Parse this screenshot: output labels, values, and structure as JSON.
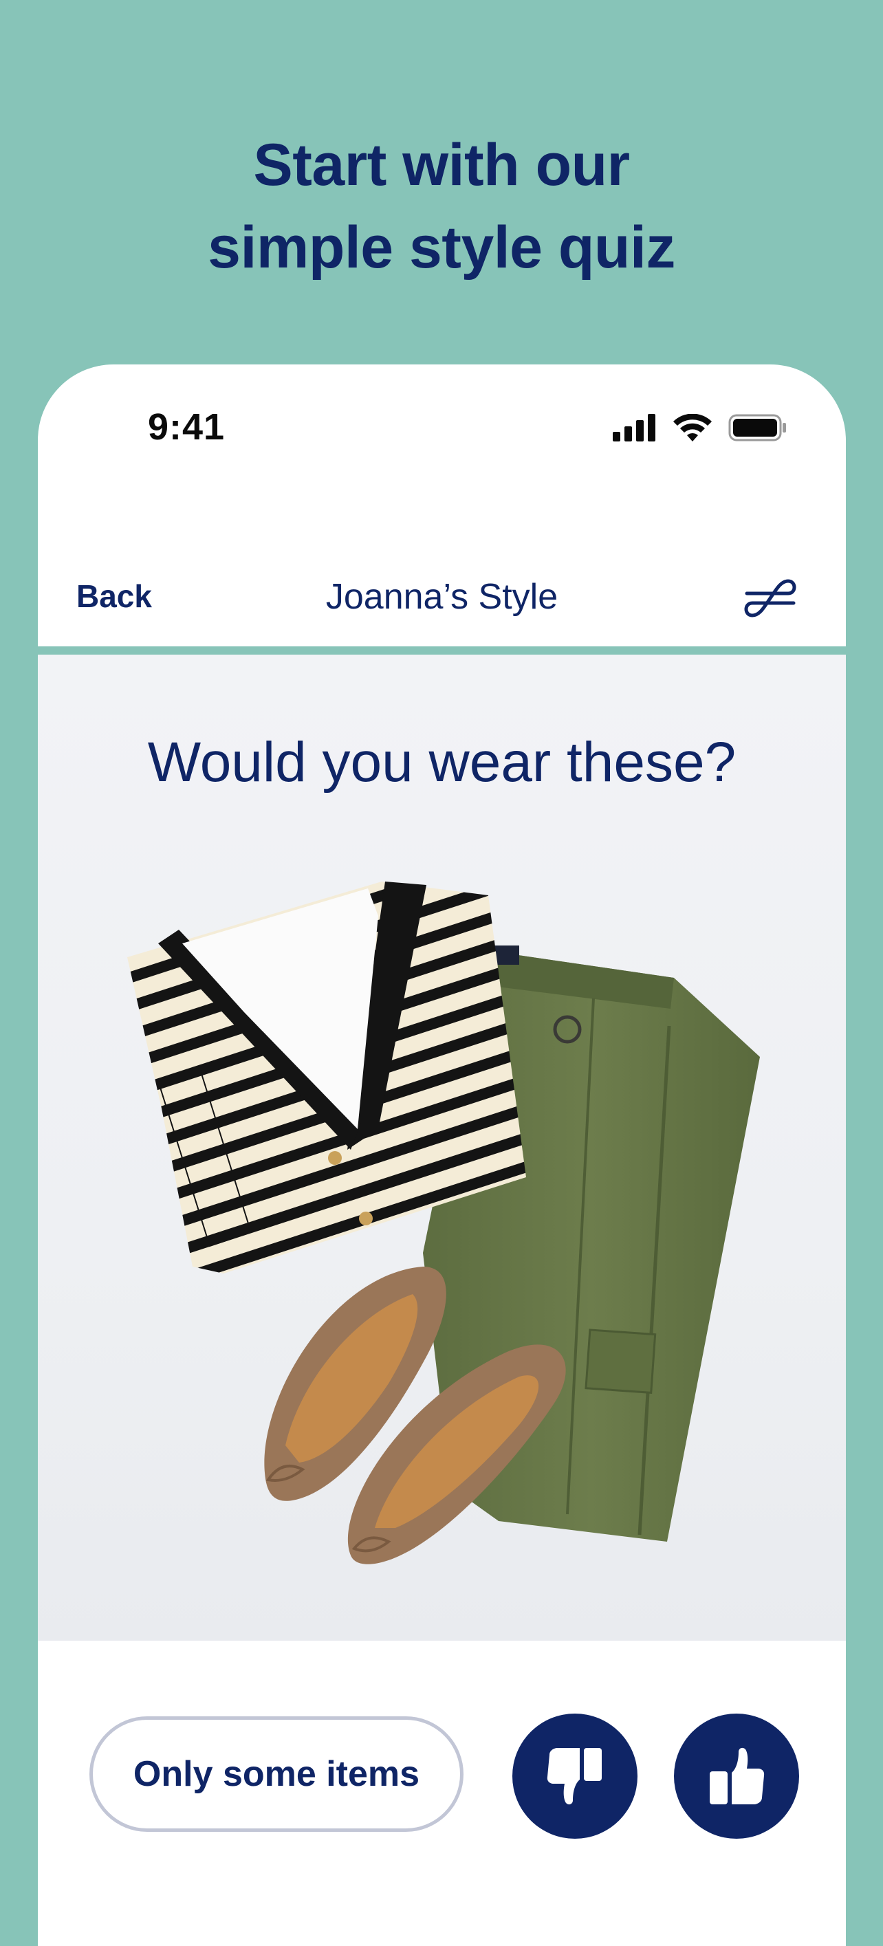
{
  "promo": {
    "headline_line1": "Start with our",
    "headline_line2": "simple style quiz"
  },
  "status_bar": {
    "time": "9:41",
    "icons": [
      "signal-icon",
      "wifi-icon",
      "battery-icon"
    ]
  },
  "nav": {
    "back_label": "Back",
    "title": "Joanna’s Style",
    "filter_icon": "style-filter-icon"
  },
  "quiz": {
    "question": "Would you wear these?",
    "image_subject": [
      "striped-cardigan",
      "white-tee",
      "olive-trousers",
      "tan-ballet-flats"
    ]
  },
  "actions": {
    "some_items_label": "Only some items",
    "dislike_icon": "thumbs-down-icon",
    "like_icon": "thumbs-up-icon"
  },
  "colors": {
    "background_teal": "#87c4b8",
    "navy": "#0f2566",
    "button_border": "#c2c6d6"
  }
}
